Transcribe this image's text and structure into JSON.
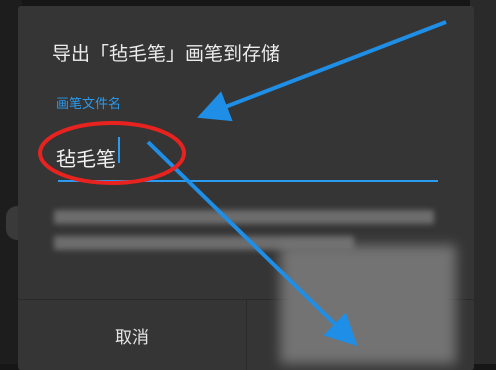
{
  "dialog": {
    "title": "导出「毡毛笔」画笔到存储",
    "field_label": "画笔文件名",
    "field_value": "毡毛笔",
    "cancel_label": "取消"
  },
  "colors": {
    "accent": "#2a9bf0",
    "annotation_circle": "#e8231f",
    "annotation_arrow": "#1e8ee6",
    "dialog_bg": "#353535"
  }
}
